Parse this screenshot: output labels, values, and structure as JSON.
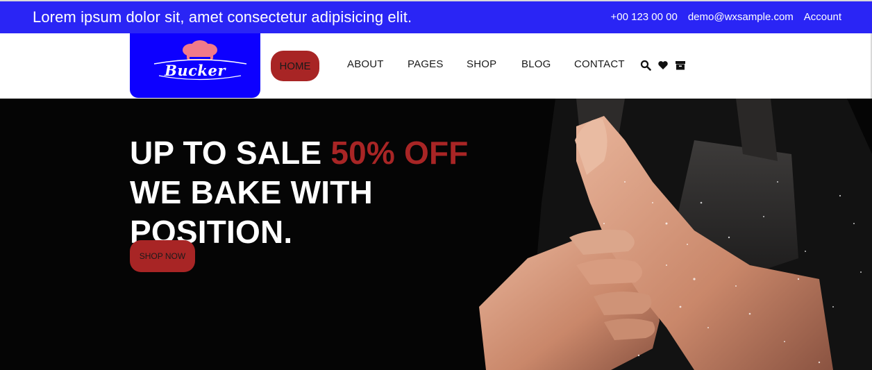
{
  "topbar": {
    "tagline": "Lorem ipsum dolor sit, amet consectetur adipisicing elit.",
    "phone": "+00 123 00 00",
    "email": "demo@wxsample.com",
    "account": "Account"
  },
  "logo": {
    "text": "Bucker",
    "icon": "chef-hat-icon"
  },
  "nav": {
    "items": [
      {
        "label": "HOME",
        "active": true
      },
      {
        "label": "ABOUT"
      },
      {
        "label": "PAGES"
      },
      {
        "label": "SHOP"
      },
      {
        "label": "BLOG"
      },
      {
        "label": "CONTACT"
      }
    ],
    "icons": [
      "search-icon",
      "heart-icon",
      "archive-icon"
    ]
  },
  "hero": {
    "line1_prefix": "UP TO SALE",
    "line1_accent": "50% OFF",
    "line2": "WE BAKE WITH",
    "line3": "POSITION.",
    "button": "SHOP NOW"
  },
  "colors": {
    "topbar_bg": "#2a25f5",
    "logo_bg": "#0d00ff",
    "accent": "#a82525",
    "hero_bg": "#050505"
  }
}
